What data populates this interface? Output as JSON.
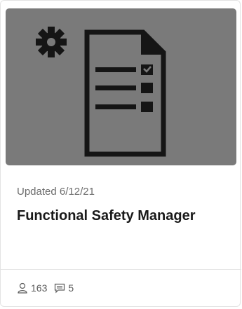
{
  "card": {
    "updated": "Updated 6/12/21",
    "title": "Functional Safety Manager",
    "thumbnail_icon": "document-checklist-gear-icon",
    "thumbnail_bg": "#7a7a7a",
    "followers": "163",
    "comments": "5"
  },
  "icons": {
    "followers": "user-icon",
    "comments": "comment-icon"
  }
}
